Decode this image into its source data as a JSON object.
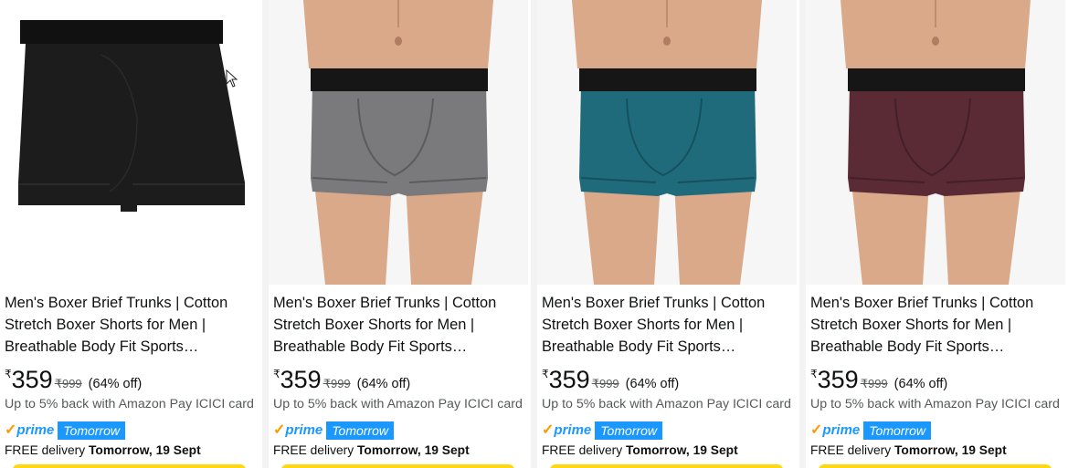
{
  "products": [
    {
      "title": "Men's Boxer Brief Trunks | Cotton Stretch Boxer Shorts for Men | Breathable Body Fit Sports…",
      "currency": "₹",
      "price": "359",
      "mrp": "₹999",
      "discount": "(64% off)",
      "cashback": "Up to 5% back with Amazon Pay ICICI card",
      "prime_label": "prime",
      "prime_badge": "Tomorrow",
      "delivery_prefix": "FREE delivery",
      "delivery_date": "Tomorrow, 19 Sept",
      "color": "#1c1c1c",
      "band_color": "#111111",
      "image_type": "flat"
    },
    {
      "title": "Men's Boxer Brief Trunks | Cotton Stretch Boxer Shorts for Men | Breathable Body Fit Sports…",
      "currency": "₹",
      "price": "359",
      "mrp": "₹999",
      "discount": "(64% off)",
      "cashback": "Up to 5% back with Amazon Pay ICICI card",
      "prime_label": "prime",
      "prime_badge": "Tomorrow",
      "delivery_prefix": "FREE delivery",
      "delivery_date": "Tomorrow, 19 Sept",
      "color": "#7a7a7c",
      "band_color": "#161616",
      "image_type": "model"
    },
    {
      "title": "Men's Boxer Brief Trunks | Cotton Stretch Boxer Shorts for Men | Breathable Body Fit Sports…",
      "currency": "₹",
      "price": "359",
      "mrp": "₹999",
      "discount": "(64% off)",
      "cashback": "Up to 5% back with Amazon Pay ICICI card",
      "prime_label": "prime",
      "prime_badge": "Tomorrow",
      "delivery_prefix": "FREE delivery",
      "delivery_date": "Tomorrow, 19 Sept",
      "color": "#1f6b7c",
      "band_color": "#161616",
      "image_type": "model"
    },
    {
      "title": "Men's Boxer Brief Trunks | Cotton Stretch Boxer Shorts for Men | Breathable Body Fit Sports…",
      "currency": "₹",
      "price": "359",
      "mrp": "₹999",
      "discount": "(64% off)",
      "cashback": "Up to 5% back with Amazon Pay ICICI card",
      "prime_label": "prime",
      "prime_badge": "Tomorrow",
      "delivery_prefix": "FREE delivery",
      "delivery_date": "Tomorrow, 19 Sept",
      "color": "#5a2a35",
      "band_color": "#161616",
      "image_type": "model"
    }
  ],
  "colors": {
    "prime_blue": "#1a98ff",
    "prime_check": "#ff9900",
    "button_yellow": "#ffd814",
    "skin": "#d9a98a",
    "muted_text": "#565959"
  }
}
